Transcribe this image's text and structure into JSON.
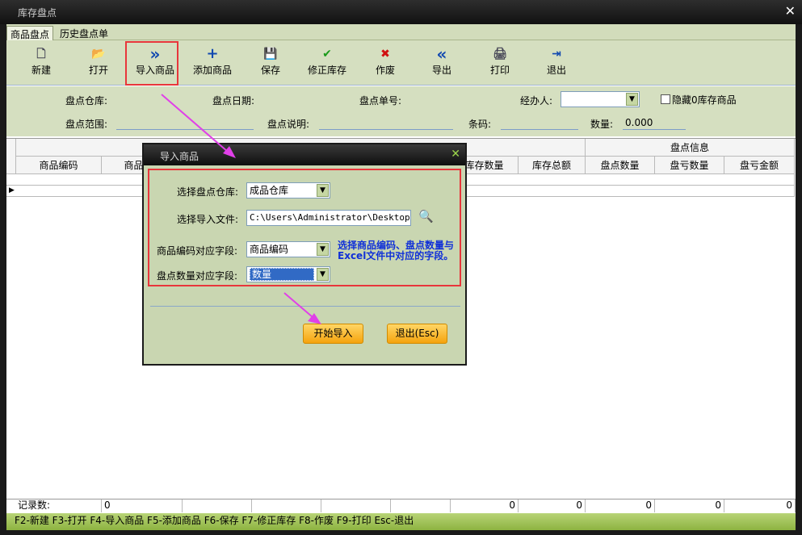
{
  "window": {
    "title": "库存盘点",
    "close": "✕"
  },
  "tabs": [
    "商品盘点",
    "历史盘点单"
  ],
  "toolbar": [
    {
      "label": "新建",
      "icon": "new-doc-icon",
      "glyph": "🗋"
    },
    {
      "label": "打开",
      "icon": "open-folder-icon",
      "glyph": "📂"
    },
    {
      "label": "导入商品",
      "icon": "double-chevron-right-icon",
      "glyph": "»"
    },
    {
      "label": "添加商品",
      "icon": "plus-icon",
      "glyph": "+"
    },
    {
      "label": "保存",
      "icon": "save-icon",
      "glyph": "💾"
    },
    {
      "label": "修正库存",
      "icon": "check-icon",
      "glyph": "✔"
    },
    {
      "label": "作废",
      "icon": "x-icon",
      "glyph": "✖"
    },
    {
      "label": "导出",
      "icon": "double-chevron-left-icon",
      "glyph": "«"
    },
    {
      "label": "打印",
      "icon": "printer-icon",
      "glyph": "🖨"
    },
    {
      "label": "退出",
      "icon": "exit-icon",
      "glyph": "⇥"
    }
  ],
  "filters": {
    "warehouse_label": "盘点仓库:",
    "date_label": "盘点日期:",
    "number_label": "盘点单号:",
    "handler_label": "经办人:",
    "hide_zero_label": "隐藏0库存商品",
    "range_label": "盘点范围:",
    "desc_label": "盘点说明:",
    "barcode_label": "条码:",
    "qty_label": "数量:",
    "qty_value": "0.000"
  },
  "grid": {
    "group_header": "盘点信息",
    "columns": [
      "商品编码",
      "商品",
      "库存数量",
      "库存总额",
      "盘点数量",
      "盘亏数量",
      "盘亏金额"
    ]
  },
  "footer": {
    "record_label": "记录数:",
    "record_value": "0",
    "totals": [
      "0",
      "0",
      "0",
      "0",
      "0"
    ]
  },
  "statusbar": "F2-新建 F3-打开 F4-导入商品 F5-添加商品 F6-保存 F7-修正库存 F8-作废 F9-打印 Esc-退出",
  "dialog": {
    "title": "导入商品",
    "close": "✕",
    "warehouse_label": "选择盘点仓库:",
    "warehouse_value": "成品仓库",
    "file_label": "选择导入文件:",
    "file_value": "C:\\Users\\Administrator\\Desktop\\盘",
    "code_field_label": "商品编码对应字段:",
    "code_field_value": "商品编码",
    "qty_field_label": "盘点数量对应字段:",
    "qty_field_value": "数量",
    "hint": "选择商品编码、盘点数量与Excel文件中对应的字段。",
    "start_button": "开始导入",
    "exit_button": "退出(Esc)"
  },
  "colors": {
    "panel": "#d5dfc0",
    "highlight": "#e8363b",
    "arrow": "#e040e8",
    "hint": "#1030d8"
  }
}
